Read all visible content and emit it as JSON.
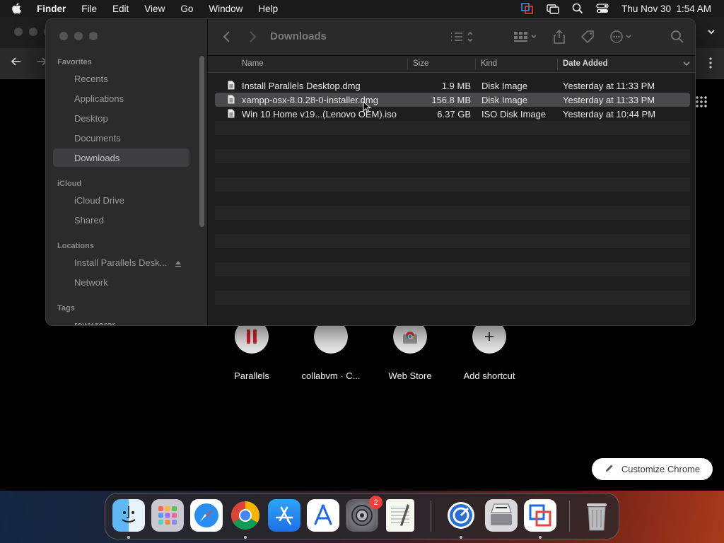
{
  "menubar": {
    "app_name": "Finder",
    "items": [
      "File",
      "Edit",
      "View",
      "Go",
      "Window",
      "Help"
    ],
    "clock": "Thu Nov 30  1:54 AM"
  },
  "finder": {
    "current_folder": "Downloads",
    "sidebar": {
      "favorites_header": "Favorites",
      "favorites": [
        "Recents",
        "Applications",
        "Desktop",
        "Documents",
        "Downloads"
      ],
      "selected": "Downloads",
      "icloud_header": "iCloud",
      "icloud": [
        "iCloud Drive",
        "Shared"
      ],
      "locations_header": "Locations",
      "locations": [
        "Install Parallels Desk...",
        "Network"
      ],
      "tags_header": "Tags",
      "tags": [
        "rewwrerer"
      ]
    },
    "columns": {
      "name": "Name",
      "size": "Size",
      "kind": "Kind",
      "date_added": "Date Added"
    },
    "files": [
      {
        "name": "Install Parallels Desktop.dmg",
        "size": "1.9 MB",
        "kind": "Disk Image",
        "date_added": "Yesterday at 11:33 PM"
      },
      {
        "name": "xampp-osx-8.0.28-0-installer.dmg",
        "size": "156.8 MB",
        "kind": "Disk Image",
        "date_added": "Yesterday at 11:33 PM"
      },
      {
        "name": "Win 10 Home v19...(Lenovo OEM).iso",
        "size": "6.37 GB",
        "kind": "ISO Disk Image",
        "date_added": "Yesterday at 10:44 PM"
      }
    ],
    "selected_file_index": 1
  },
  "chrome": {
    "shortcuts": [
      "Parallels",
      "collabvm · C...",
      "Web Store",
      "Add shortcut"
    ],
    "customize_label": "Customize Chrome"
  },
  "dock": {
    "apps": [
      "finder-icon",
      "launchpad-icon",
      "safari-icon",
      "chrome-icon",
      "app-store-icon",
      "xcode-icon",
      "system-settings-icon",
      "textedit-icon",
      "safari-download-icon",
      "parallels-desktop-icon",
      "parallels-installer-icon",
      "trash-icon"
    ],
    "system_settings_badge": "2"
  }
}
